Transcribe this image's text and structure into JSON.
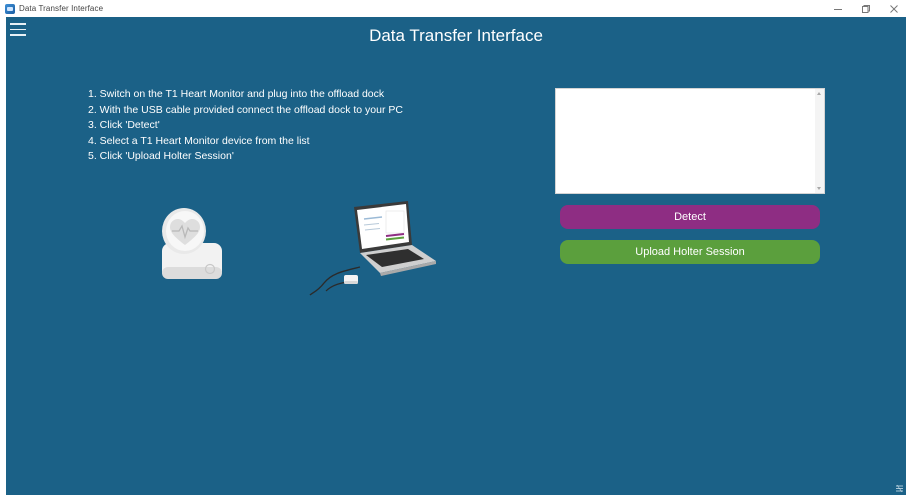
{
  "window": {
    "title": "Data Transfer Interface",
    "controls": [
      "minimize",
      "restore",
      "close"
    ]
  },
  "header": {
    "title": "Data Transfer Interface",
    "menu_icon": "hamburger-menu-icon"
  },
  "instructions": [
    "1. Switch on the T1 Heart Monitor and plug into the offload dock",
    "2. With the USB cable provided connect the offload dock to your PC",
    "3. Click 'Detect'",
    "4. Select a T1 Heart Monitor device from the list",
    "5. Click 'Upload Holter Session'"
  ],
  "output": {
    "value": ""
  },
  "actions": {
    "detect_label": "Detect",
    "upload_label": "Upload Holter Session"
  },
  "colors": {
    "background": "#1b6187",
    "detect": "#8e2d83",
    "upload": "#5b9f3d"
  }
}
